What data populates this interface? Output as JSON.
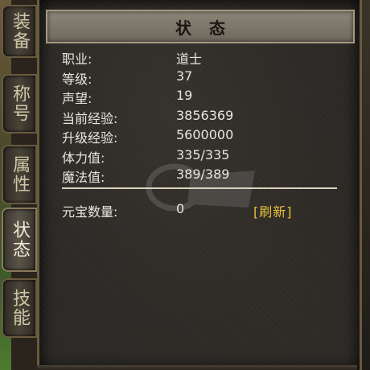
{
  "tabs": [
    {
      "label": "装备",
      "active": false
    },
    {
      "label": "称号",
      "active": false
    },
    {
      "label": "属性",
      "active": false
    },
    {
      "label": "状态",
      "active": true
    },
    {
      "label": "技能",
      "active": false
    }
  ],
  "panel": {
    "title": "状态"
  },
  "stats": [
    {
      "label": "职业:",
      "value": "道士"
    },
    {
      "label": "等级:",
      "value": "37"
    },
    {
      "label": "声望:",
      "value": "19"
    },
    {
      "label": "当前经验:",
      "value": "3856369"
    },
    {
      "label": "升级经验:",
      "value": "5600000"
    },
    {
      "label": "体力值:",
      "value": "335/335"
    },
    {
      "label": "魔法值:",
      "value": "389/389"
    }
  ],
  "ingot": {
    "label": "元宝数量:",
    "value": "0",
    "refresh_label": "[刷新]"
  },
  "colors": {
    "text": "#e9e6dc",
    "refresh": "#e8c23a",
    "header_bg": "#7d776b"
  }
}
